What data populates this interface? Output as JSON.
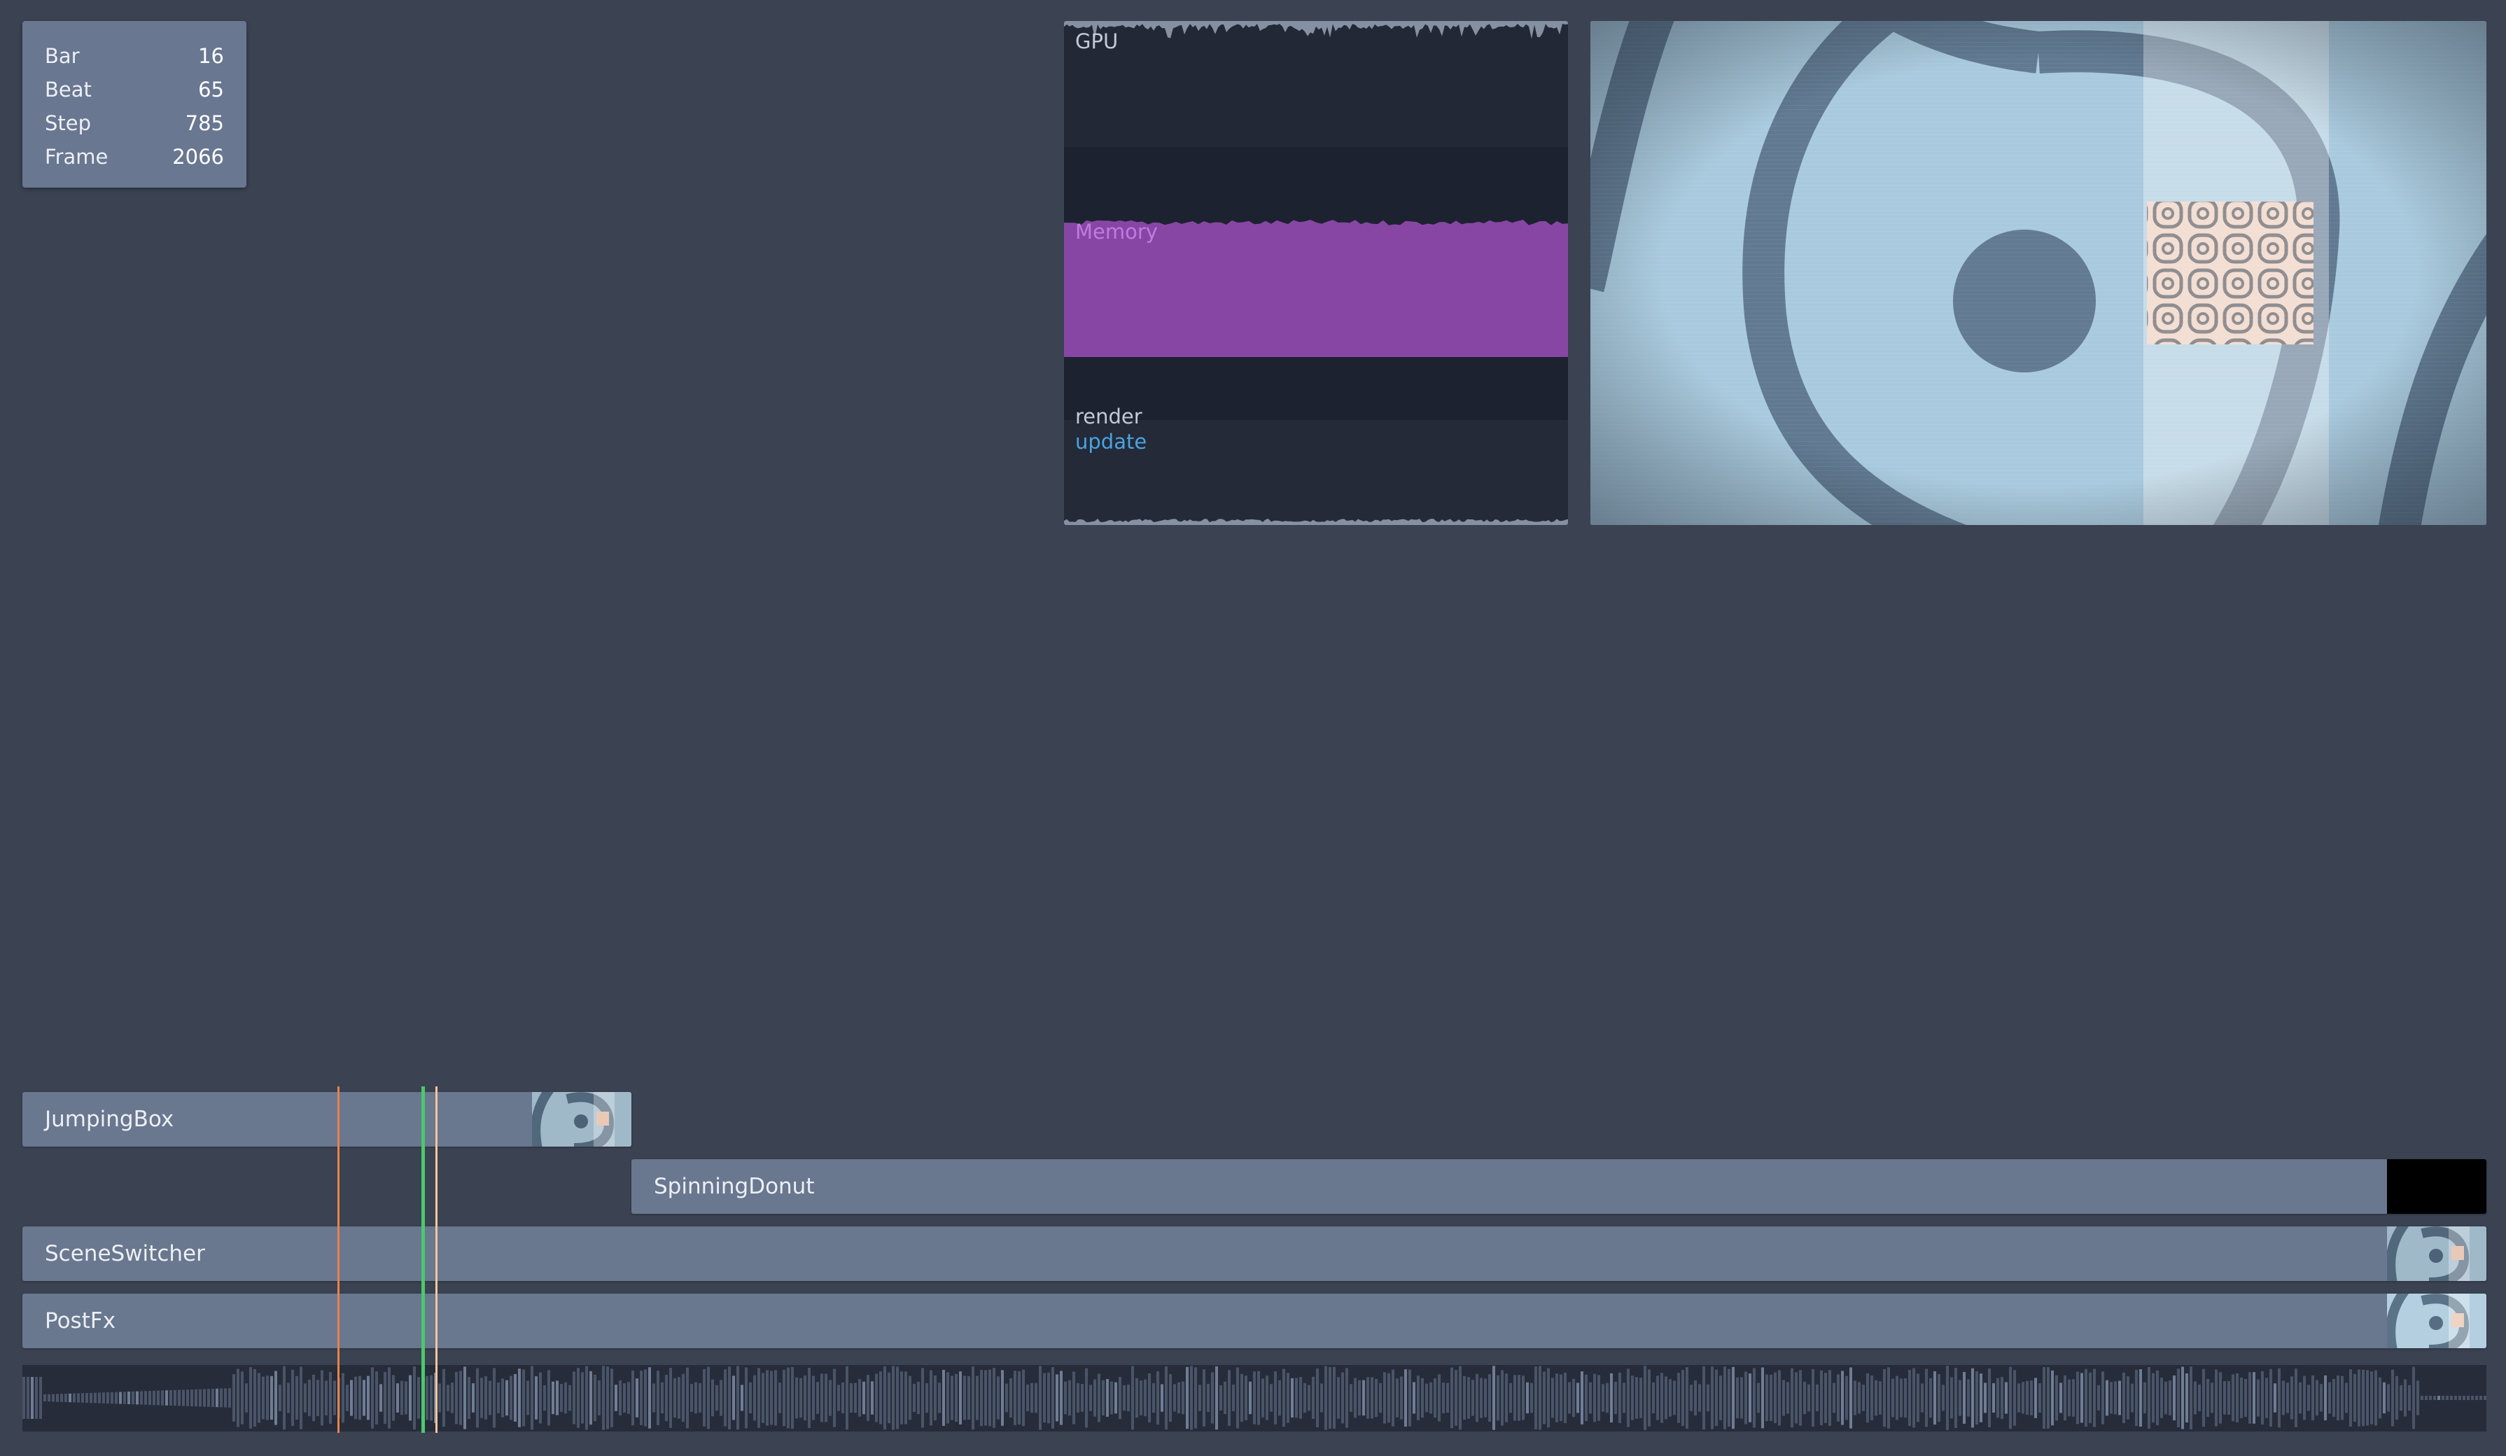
{
  "stats": [
    {
      "label": "Bar",
      "value": "16"
    },
    {
      "label": "Beat",
      "value": "65"
    },
    {
      "label": "Step",
      "value": "785"
    },
    {
      "label": "Frame",
      "value": "2066"
    }
  ],
  "perf": {
    "gpu_label": "GPU",
    "memory_label": "Memory",
    "render_label": "render",
    "update_label": "update",
    "colors": {
      "memory": "#8746a4",
      "memory_text": "#b96ad9",
      "update": "#4aa3df"
    }
  },
  "timeline": {
    "clips": [
      {
        "name": "JumpingBox",
        "thumb": "donut-preview"
      },
      {
        "name": "SpinningDonut",
        "thumb": "black"
      },
      {
        "name": "SceneSwitcher",
        "thumb": "donut-preview"
      },
      {
        "name": "PostFx",
        "thumb": "donut-preview"
      }
    ],
    "colors": {
      "playhead": "#4cc96b",
      "marker_a": "#e8834a",
      "marker_b": "#f5c89a"
    }
  }
}
